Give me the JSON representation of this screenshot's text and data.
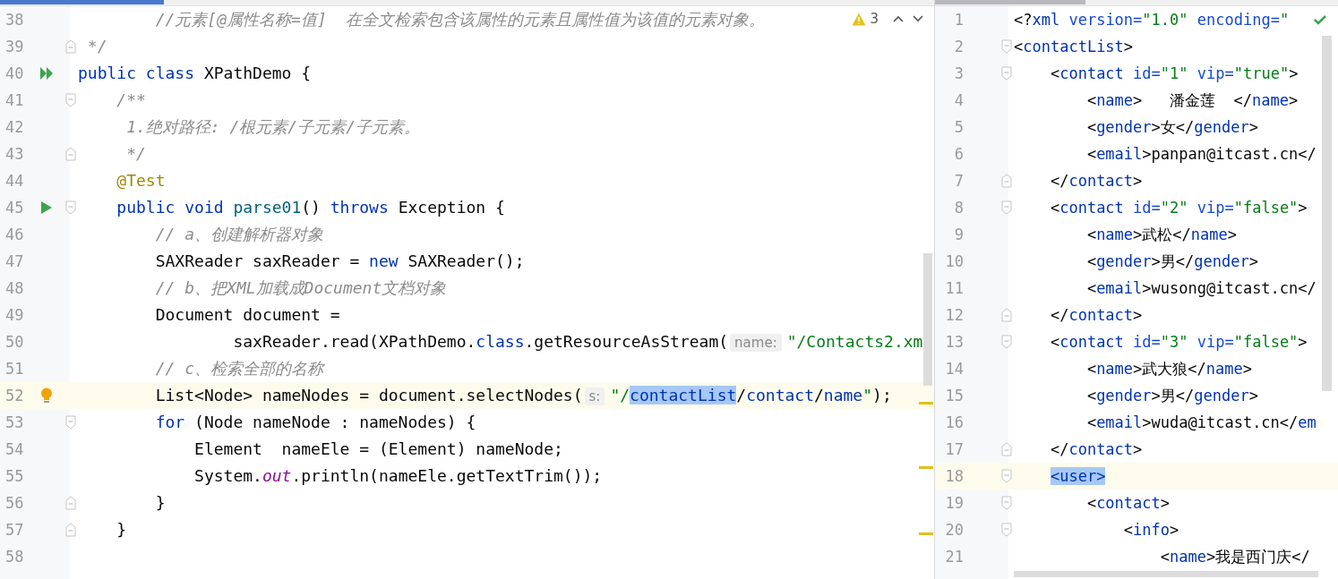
{
  "editors": [
    {
      "status": {
        "kind": "warnings",
        "count": "3"
      },
      "lines": [
        {
          "n": "38",
          "current": false,
          "tokens": [
            {
              "kind": "cm",
              "text": "        //元素[@属性名称=值]  在全文检索包含该属性的元素且属性值为该值的元素对象。"
            }
          ]
        },
        {
          "n": "39",
          "current": false,
          "fold": {
            "kind": "end"
          },
          "tokens": [
            {
              "kind": "cm",
              "text": " */"
            }
          ]
        },
        {
          "n": "40",
          "current": false,
          "marker": {
            "kind": "run_all"
          },
          "tokens": [
            {
              "kind": "kw",
              "text": "public class "
            },
            {
              "kind": "p",
              "text": "XPathDemo {"
            }
          ]
        },
        {
          "n": "41",
          "current": false,
          "fold": {
            "kind": "start"
          },
          "tokens": [
            {
              "kind": "cm",
              "text": "    /**"
            }
          ]
        },
        {
          "n": "42",
          "current": false,
          "tokens": [
            {
              "kind": "cm",
              "text": "     1.绝对路径: /根元素/子元素/子元素。"
            }
          ]
        },
        {
          "n": "43",
          "current": false,
          "fold": {
            "kind": "end"
          },
          "tokens": [
            {
              "kind": "cm",
              "text": "     */"
            }
          ]
        },
        {
          "n": "44",
          "current": false,
          "tokens": [
            {
              "kind": "ann",
              "text": "    @Test"
            }
          ]
        },
        {
          "n": "45",
          "current": false,
          "marker": {
            "kind": "run"
          },
          "fold": {
            "kind": "start"
          },
          "tokens": [
            {
              "kind": "kw",
              "text": "    public void "
            },
            {
              "kind": "fn",
              "text": "parse01"
            },
            {
              "kind": "p",
              "text": "() "
            },
            {
              "kind": "kw",
              "text": "throws "
            },
            {
              "kind": "p",
              "text": "Exception {"
            }
          ]
        },
        {
          "n": "46",
          "current": false,
          "tokens": [
            {
              "kind": "cm",
              "text": "        // a、创建解析器对象"
            }
          ]
        },
        {
          "n": "47",
          "current": false,
          "tokens": [
            {
              "kind": "p",
              "text": "        SAXReader saxReader = "
            },
            {
              "kind": "kw",
              "text": "new "
            },
            {
              "kind": "p",
              "text": "SAXReader();"
            }
          ]
        },
        {
          "n": "48",
          "current": false,
          "tokens": [
            {
              "kind": "cm",
              "text": "        // b、把XML加载成Document文档对象"
            }
          ]
        },
        {
          "n": "49",
          "current": false,
          "tokens": [
            {
              "kind": "p",
              "text": "        Document document ="
            }
          ]
        },
        {
          "n": "50",
          "current": false,
          "tokens": [
            {
              "kind": "p",
              "text": "                saxReader.read(XPathDemo."
            },
            {
              "kind": "kw",
              "text": "class"
            },
            {
              "kind": "p",
              "text": ".getResourceAsStream("
            },
            {
              "kind": "hint",
              "text": "name:"
            },
            {
              "kind": "str",
              "text": "\"/Contacts2.xm"
            }
          ]
        },
        {
          "n": "51",
          "current": false,
          "tokens": [
            {
              "kind": "cm",
              "text": "        // c、检索全部的名称"
            }
          ]
        },
        {
          "n": "52",
          "current": true,
          "marker": {
            "kind": "bulb"
          },
          "tokens": [
            {
              "kind": "p",
              "text": "        List<Node> nameNodes = document.selectNodes("
            },
            {
              "kind": "hint",
              "text": "s:"
            },
            {
              "kind": "str",
              "text": "\"/"
            },
            {
              "kind": "sel",
              "text": "contactList"
            },
            {
              "kind": "p",
              "text": "/"
            },
            {
              "kind": "xp",
              "text": "contact"
            },
            {
              "kind": "p",
              "text": "/"
            },
            {
              "kind": "xp",
              "text": "name"
            },
            {
              "kind": "str",
              "text": "\""
            },
            {
              "kind": "p",
              "text": ");"
            }
          ]
        },
        {
          "n": "53",
          "current": false,
          "fold": {
            "kind": "start"
          },
          "tokens": [
            {
              "kind": "kw",
              "text": "        for "
            },
            {
              "kind": "p",
              "text": "(Node nameNode : nameNodes) {"
            }
          ]
        },
        {
          "n": "54",
          "current": false,
          "tokens": [
            {
              "kind": "p",
              "text": "            Element  nameEle = (Element) nameNode;"
            }
          ]
        },
        {
          "n": "55",
          "current": false,
          "tokens": [
            {
              "kind": "p",
              "text": "            System."
            },
            {
              "kind": "st",
              "text": "out"
            },
            {
              "kind": "p",
              "text": ".println(nameEle.getTextTrim());"
            }
          ]
        },
        {
          "n": "56",
          "current": false,
          "fold": {
            "kind": "end"
          },
          "tokens": [
            {
              "kind": "p",
              "text": "        }"
            }
          ]
        },
        {
          "n": "57",
          "current": false,
          "fold": {
            "kind": "end"
          },
          "tokens": [
            {
              "kind": "p",
              "text": "    }"
            }
          ]
        },
        {
          "n": "58",
          "current": false
        }
      ]
    },
    {
      "status": {
        "kind": "ok"
      },
      "lines": [
        {
          "n": "1",
          "current": false,
          "tokens": [
            {
              "kind": "p",
              "text": "<?"
            },
            {
              "kind": "tag",
              "text": "xml "
            },
            {
              "kind": "attr",
              "text": "version="
            },
            {
              "kind": "val",
              "text": "\"1.0\" "
            },
            {
              "kind": "attr",
              "text": "encoding="
            },
            {
              "kind": "val",
              "text": "\""
            }
          ]
        },
        {
          "n": "2",
          "current": false,
          "fold": {
            "kind": "start"
          },
          "tokens": [
            {
              "kind": "p",
              "text": "<"
            },
            {
              "kind": "tag",
              "text": "contactList"
            },
            {
              "kind": "p",
              "text": ">"
            }
          ]
        },
        {
          "n": "3",
          "current": false,
          "fold": {
            "kind": "start"
          },
          "tokens": [
            {
              "kind": "p",
              "text": "    <"
            },
            {
              "kind": "tag",
              "text": "contact "
            },
            {
              "kind": "attr",
              "text": "id="
            },
            {
              "kind": "val",
              "text": "\"1\" "
            },
            {
              "kind": "attr",
              "text": "vip="
            },
            {
              "kind": "val",
              "text": "\"true\""
            },
            {
              "kind": "p",
              "text": ">"
            }
          ]
        },
        {
          "n": "4",
          "current": false,
          "tokens": [
            {
              "kind": "p",
              "text": "        <"
            },
            {
              "kind": "tag",
              "text": "name"
            },
            {
              "kind": "p",
              "text": ">   潘金莲  </"
            },
            {
              "kind": "tag",
              "text": "name"
            },
            {
              "kind": "p",
              "text": ">"
            }
          ]
        },
        {
          "n": "5",
          "current": false,
          "tokens": [
            {
              "kind": "p",
              "text": "        <"
            },
            {
              "kind": "tag",
              "text": "gender"
            },
            {
              "kind": "p",
              "text": ">女</"
            },
            {
              "kind": "tag",
              "text": "gender"
            },
            {
              "kind": "p",
              "text": ">"
            }
          ]
        },
        {
          "n": "6",
          "current": false,
          "tokens": [
            {
              "kind": "p",
              "text": "        <"
            },
            {
              "kind": "tag",
              "text": "email"
            },
            {
              "kind": "p",
              "text": ">panpan@itcast.cn</"
            }
          ]
        },
        {
          "n": "7",
          "current": false,
          "fold": {
            "kind": "end"
          },
          "tokens": [
            {
              "kind": "p",
              "text": "    </"
            },
            {
              "kind": "tag",
              "text": "contact"
            },
            {
              "kind": "p",
              "text": ">"
            }
          ]
        },
        {
          "n": "8",
          "current": false,
          "fold": {
            "kind": "start"
          },
          "tokens": [
            {
              "kind": "p",
              "text": "    <"
            },
            {
              "kind": "tag",
              "text": "contact "
            },
            {
              "kind": "attr",
              "text": "id="
            },
            {
              "kind": "val",
              "text": "\"2\" "
            },
            {
              "kind": "attr",
              "text": "vip="
            },
            {
              "kind": "val",
              "text": "\"false\""
            },
            {
              "kind": "p",
              "text": ">"
            }
          ]
        },
        {
          "n": "9",
          "current": false,
          "tokens": [
            {
              "kind": "p",
              "text": "        <"
            },
            {
              "kind": "tag",
              "text": "name"
            },
            {
              "kind": "p",
              "text": ">武松</"
            },
            {
              "kind": "tag",
              "text": "name"
            },
            {
              "kind": "p",
              "text": ">"
            }
          ]
        },
        {
          "n": "10",
          "current": false,
          "tokens": [
            {
              "kind": "p",
              "text": "        <"
            },
            {
              "kind": "tag",
              "text": "gender"
            },
            {
              "kind": "p",
              "text": ">男</"
            },
            {
              "kind": "tag",
              "text": "gender"
            },
            {
              "kind": "p",
              "text": ">"
            }
          ]
        },
        {
          "n": "11",
          "current": false,
          "tokens": [
            {
              "kind": "p",
              "text": "        <"
            },
            {
              "kind": "tag",
              "text": "email"
            },
            {
              "kind": "p",
              "text": ">wusong@itcast.cn</"
            }
          ]
        },
        {
          "n": "12",
          "current": false,
          "fold": {
            "kind": "end"
          },
          "tokens": [
            {
              "kind": "p",
              "text": "    </"
            },
            {
              "kind": "tag",
              "text": "contact"
            },
            {
              "kind": "p",
              "text": ">"
            }
          ]
        },
        {
          "n": "13",
          "current": false,
          "fold": {
            "kind": "start"
          },
          "tokens": [
            {
              "kind": "p",
              "text": "    <"
            },
            {
              "kind": "tag",
              "text": "contact "
            },
            {
              "kind": "attr",
              "text": "id="
            },
            {
              "kind": "val",
              "text": "\"3\" "
            },
            {
              "kind": "attr",
              "text": "vip="
            },
            {
              "kind": "val",
              "text": "\"false\""
            },
            {
              "kind": "p",
              "text": ">"
            }
          ]
        },
        {
          "n": "14",
          "current": false,
          "tokens": [
            {
              "kind": "p",
              "text": "        <"
            },
            {
              "kind": "tag",
              "text": "name"
            },
            {
              "kind": "p",
              "text": ">武大狼</"
            },
            {
              "kind": "tag",
              "text": "name"
            },
            {
              "kind": "p",
              "text": ">"
            }
          ]
        },
        {
          "n": "15",
          "current": false,
          "tokens": [
            {
              "kind": "p",
              "text": "        <"
            },
            {
              "kind": "tag",
              "text": "gender"
            },
            {
              "kind": "p",
              "text": ">男</"
            },
            {
              "kind": "tag",
              "text": "gender"
            },
            {
              "kind": "p",
              "text": ">"
            }
          ]
        },
        {
          "n": "16",
          "current": false,
          "tokens": [
            {
              "kind": "p",
              "text": "        <"
            },
            {
              "kind": "tag",
              "text": "email"
            },
            {
              "kind": "p",
              "text": ">wuda@itcast.cn</"
            },
            {
              "kind": "tag",
              "text": "em"
            }
          ]
        },
        {
          "n": "17",
          "current": false,
          "fold": {
            "kind": "end"
          },
          "tokens": [
            {
              "kind": "p",
              "text": "    </"
            },
            {
              "kind": "tag",
              "text": "contact"
            },
            {
              "kind": "p",
              "text": ">"
            }
          ]
        },
        {
          "n": "18",
          "current": true,
          "fold": {
            "kind": "start"
          },
          "tokens": [
            {
              "kind": "sel",
              "text": "    <user>"
            }
          ]
        },
        {
          "n": "19",
          "current": false,
          "fold": {
            "kind": "start"
          },
          "tokens": [
            {
              "kind": "p",
              "text": "        <"
            },
            {
              "kind": "tag",
              "text": "contact"
            },
            {
              "kind": "p",
              "text": ">"
            }
          ]
        },
        {
          "n": "20",
          "current": false,
          "fold": {
            "kind": "start"
          },
          "tokens": [
            {
              "kind": "p",
              "text": "            <"
            },
            {
              "kind": "tag",
              "text": "info"
            },
            {
              "kind": "p",
              "text": ">"
            }
          ]
        },
        {
          "n": "21",
          "current": false,
          "tokens": [
            {
              "kind": "p",
              "text": "                <"
            },
            {
              "kind": "tag",
              "text": "name"
            },
            {
              "kind": "p",
              "text": ">我是西门庆</"
            }
          ]
        }
      ]
    }
  ]
}
